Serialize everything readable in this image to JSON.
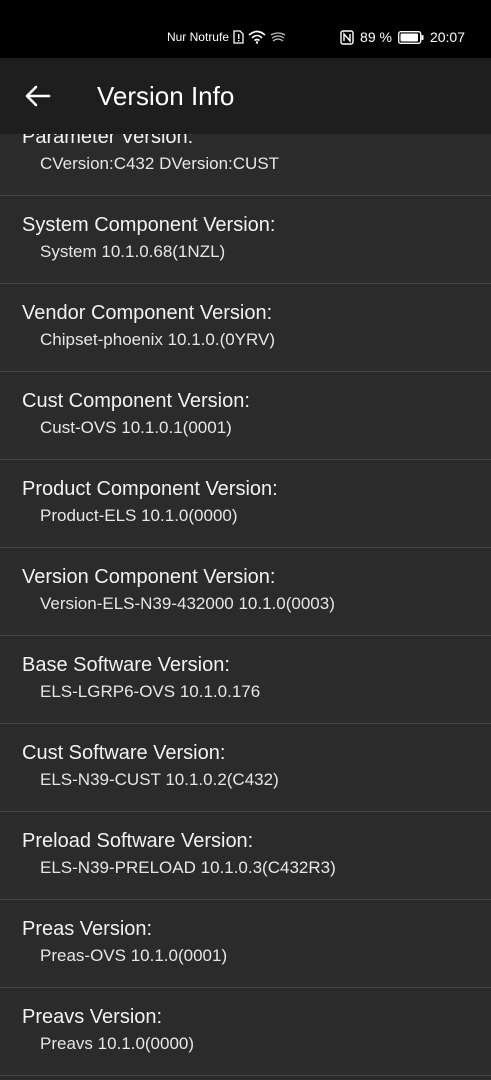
{
  "status_bar": {
    "carrier": "Nur Notrufe",
    "battery_percent": "89 %",
    "time": "20:07",
    "icons": [
      "sim-alert-icon",
      "wifi-icon",
      "wireless-charge-icon",
      "nfc-icon",
      "battery-icon"
    ]
  },
  "app_bar": {
    "back_icon": "arrow-left-icon",
    "title": "Version Info"
  },
  "items": [
    {
      "title": "Parameter Version:",
      "value": "CVersion:C432 DVersion:CUST"
    },
    {
      "title": "System Component Version:",
      "value": "System 10.1.0.68(1NZL)"
    },
    {
      "title": "Vendor Component Version:",
      "value": "Chipset-phoenix 10.1.0.(0YRV)"
    },
    {
      "title": "Cust Component Version:",
      "value": "Cust-OVS 10.1.0.1(0001)"
    },
    {
      "title": "Product Component Version:",
      "value": "Product-ELS 10.1.0(0000)"
    },
    {
      "title": "Version Component Version:",
      "value": "Version-ELS-N39-432000 10.1.0(0003)"
    },
    {
      "title": "Base Software Version:",
      "value": "ELS-LGRP6-OVS 10.1.0.176"
    },
    {
      "title": "Cust Software Version:",
      "value": "ELS-N39-CUST 10.1.0.2(C432)"
    },
    {
      "title": "Preload Software Version:",
      "value": "ELS-N39-PRELOAD 10.1.0.3(C432R3)"
    },
    {
      "title": "Preas Version:",
      "value": "Preas-OVS 10.1.0(0001)"
    },
    {
      "title": "Preavs Version:",
      "value": "Preavs 10.1.0(0000)"
    }
  ]
}
